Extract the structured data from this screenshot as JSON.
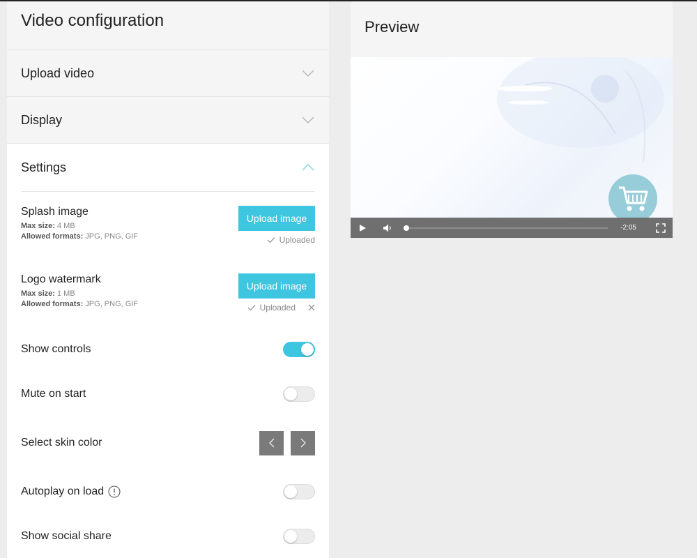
{
  "config": {
    "title": "Video configuration",
    "sections": [
      {
        "label": "Upload video",
        "state": "collapsed"
      },
      {
        "label": "Display",
        "state": "collapsed"
      },
      {
        "label": "Settings",
        "state": "expanded"
      }
    ],
    "splash": {
      "name": "Splash image",
      "max_size_label": "Max size:",
      "max_size": "4 MB",
      "formats_label": "Allowed formats:",
      "formats": "JPG, PNG, GIF",
      "button": "Upload image",
      "status": "Uploaded"
    },
    "logo": {
      "name": "Logo watermark",
      "max_size_label": "Max size:",
      "max_size": "1 MB",
      "formats_label": "Allowed formats:",
      "formats": "JPG, PNG, GIF",
      "button": "Upload image",
      "status": "Uploaded"
    },
    "show_controls": {
      "label": "Show controls",
      "on": true
    },
    "mute_on_start": {
      "label": "Mute on start",
      "on": false
    },
    "skin_color": {
      "label": "Select skin color"
    },
    "autoplay": {
      "label": "Autoplay on load",
      "on": false
    },
    "social_share": {
      "label": "Show social share",
      "on": false
    }
  },
  "preview": {
    "title": "Preview",
    "time_remaining": "-2:05",
    "progress": 0.0
  },
  "colors": {
    "accent": "#3ec5e0",
    "skin_button": "#7a7a7a",
    "control_bar": "#6f6f6f"
  },
  "icons": [
    "chevron-down-icon",
    "chevron-up-icon",
    "check-icon",
    "close-icon",
    "info-icon",
    "chevron-left-icon",
    "chevron-right-icon",
    "play-icon",
    "volume-icon",
    "fullscreen-icon",
    "cart-icon"
  ]
}
